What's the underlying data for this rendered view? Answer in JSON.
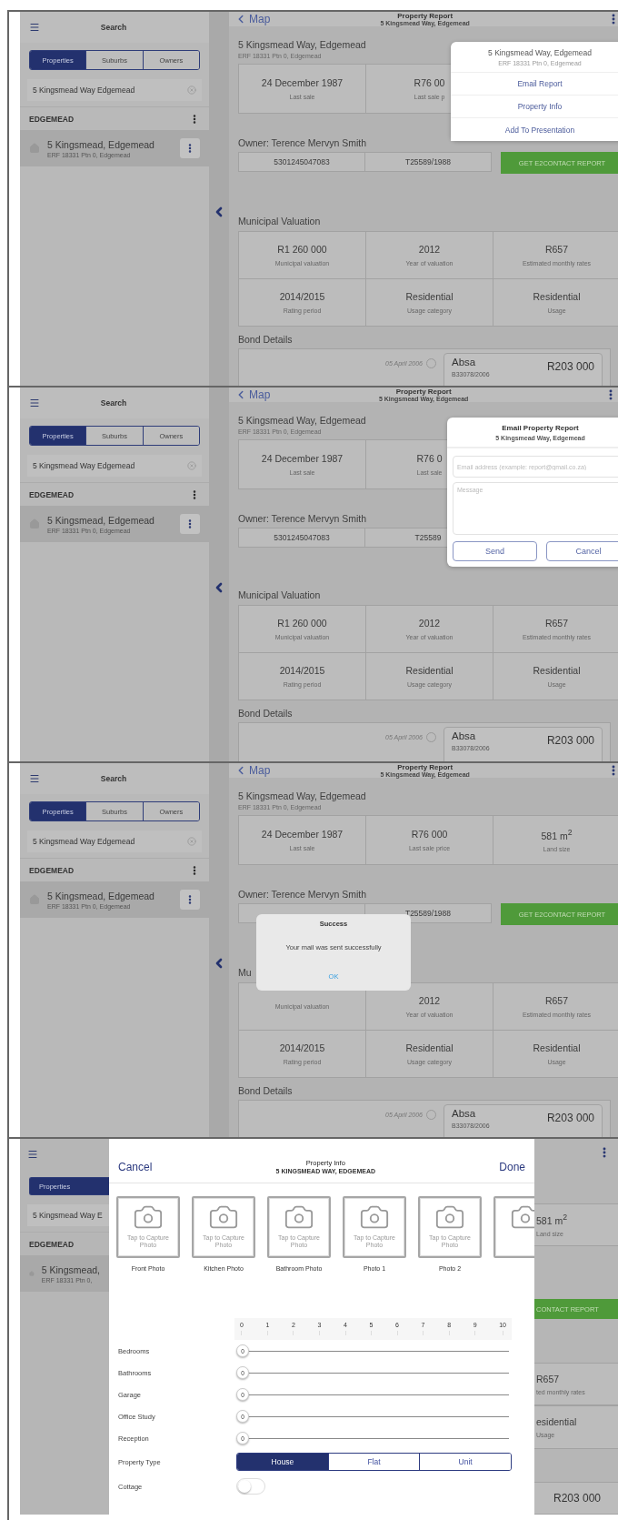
{
  "panels": [
    {
      "kind": "menu",
      "screen": {
        "sidebar": {
          "title": "Search",
          "tabs": [
            {
              "label": "Properties",
              "selected": true
            },
            {
              "label": "Suburbs",
              "selected": false
            },
            {
              "label": "Owners",
              "selected": false
            }
          ],
          "search": {
            "value": "5 Kingsmead Way Edgemead"
          },
          "group": "EDGEMEAD",
          "result": {
            "title": "5 Kingsmead, Edgemead",
            "subtitle": "ERF 18331 Ptn 0, Edgemead",
            "selected": true
          }
        },
        "nav": {
          "back": "Map",
          "title": "Property Report",
          "subtitle": "5 Kingsmead Way, Edgemead"
        },
        "property": {
          "address": "5 Kingsmead Way, Edgemead",
          "erf": "ERF 18331 Ptn 0, Edgemead"
        },
        "stats": [
          {
            "value": "24 December 1987",
            "label": "Last sale"
          },
          {
            "value": "R76 00",
            "label": "Last sale p"
          }
        ],
        "owner": {
          "heading": "Owner: Terence Mervyn Smith",
          "ids": [
            "5301245047083",
            "T25589/1988"
          ],
          "button": "GET E2CONTACT REPORT"
        },
        "valuation": {
          "heading": "Municipal Valuation",
          "cells": [
            {
              "value": "R1 260 000",
              "label": "Municipal valuation"
            },
            {
              "value": "2012",
              "label": "Year of valuation"
            },
            {
              "value": "R657",
              "label": "Estimated monthly rates"
            },
            {
              "value": "2014/2015",
              "label": "Rating period"
            },
            {
              "value": "Residential",
              "label": "Usage category"
            },
            {
              "value": "Residential",
              "label": "Usage"
            }
          ]
        },
        "bond": {
          "heading": "Bond Details",
          "date": "05 April 2006",
          "bank": "Absa",
          "reference": "B33078/2006",
          "amount": "R203 000"
        }
      },
      "menu": {
        "title": "5 Kingsmead Way, Edgemead",
        "subtitle": "ERF 18331 Ptn 0, Edgemead",
        "items": [
          "Email Report",
          "Property Info",
          "Add To Presentation"
        ]
      }
    },
    {
      "kind": "email",
      "screen": {
        "sidebar": {
          "title": "Search",
          "tabs": [
            {
              "label": "Properties",
              "selected": true
            },
            {
              "label": "Suburbs",
              "selected": false
            },
            {
              "label": "Owners",
              "selected": false
            }
          ],
          "search": {
            "value": "5 Kingsmead Way Edgemead"
          },
          "group": "EDGEMEAD",
          "result": {
            "title": "5 Kingsmead, Edgemead",
            "subtitle": "ERF 18331 Ptn 0, Edgemead",
            "selected": true
          }
        },
        "nav": {
          "back": "Map",
          "title": "Property Report",
          "subtitle": "5 Kingsmead Way, Edgemead"
        },
        "property": {
          "address": "5 Kingsmead Way, Edgemead",
          "erf": "ERF 18331 Ptn 0, Edgemead"
        },
        "stats": [
          {
            "value": "24 December 1987",
            "label": "Last sale"
          },
          {
            "value": "R76 0",
            "label": "Last sale"
          }
        ],
        "owner": {
          "heading": "Owner: Terence Mervyn Smith",
          "ids": [
            "5301245047083",
            "T25589"
          ]
        },
        "valuation": {
          "heading": "Municipal Valuation",
          "cells": [
            {
              "value": "R1 260 000",
              "label": "Municipal valuation"
            },
            {
              "value": "2012",
              "label": "Year of valuation"
            },
            {
              "value": "R657",
              "label": "Estimated monthly rates"
            },
            {
              "value": "2014/2015",
              "label": "Rating period"
            },
            {
              "value": "Residential",
              "label": "Usage category"
            },
            {
              "value": "Residential",
              "label": "Usage"
            }
          ]
        },
        "bond": {
          "heading": "Bond Details",
          "date": "05 April 2006",
          "bank": "Absa",
          "reference": "B33078/2006",
          "amount": "R203 000"
        }
      },
      "email_form": {
        "title": "Email Property Report",
        "subtitle": "5 Kingsmead Way, Edgemead",
        "email": {
          "placeholder": "Email address (example: report@gmail.co.za)"
        },
        "message": {
          "placeholder": "Message"
        },
        "buttons": [
          "Send",
          "Cancel"
        ]
      }
    },
    {
      "kind": "alert",
      "screen": {
        "sidebar": {
          "title": "Search",
          "tabs": [
            {
              "label": "Properties",
              "selected": true
            },
            {
              "label": "Suburbs",
              "selected": false
            },
            {
              "label": "Owners",
              "selected": false
            }
          ],
          "search": {
            "value": "5 Kingsmead Way Edgemead"
          },
          "group": "EDGEMEAD",
          "result": {
            "title": "5 Kingsmead, Edgemead",
            "subtitle": "ERF 18331 Ptn 0, Edgemead",
            "selected": true
          }
        },
        "nav": {
          "back": "Map",
          "title": "Property Report",
          "subtitle": "5 Kingsmead Way, Edgemead"
        },
        "property": {
          "address": "5 Kingsmead Way, Edgemead",
          "erf": "ERF 18331 Ptn 0, Edgemead"
        },
        "stats": [
          {
            "value": "24 December 1987",
            "label": "Last sale"
          },
          {
            "value": "R76 000",
            "label": "Last sale price"
          },
          {
            "value": "581 m$^{2}$",
            "label": "Land size"
          }
        ],
        "owner": {
          "heading": "Owner: Terence Mervyn Smith",
          "ids": [
            "T25589/1988"
          ],
          "button": "GET E2CONTACT REPORT"
        },
        "valuation": {
          "heading": "Mu",
          "cells": [
            {
              "label": "Municipal valuation"
            },
            {
              "value": "2012",
              "label": "Year of valuation"
            },
            {
              "value": "R657",
              "label": "Estimated monthly rates"
            },
            {
              "value": "2014/2015",
              "label": "Rating period"
            },
            {
              "value": "Residential",
              "label": "Usage category"
            },
            {
              "value": "Residential",
              "label": "Usage"
            }
          ]
        },
        "bond": {
          "heading": "Bond Details",
          "date": "05 April 2006",
          "bank": "Absa",
          "reference": "B33078/2006",
          "amount": "R203 000"
        }
      },
      "alert": {
        "title": "Success",
        "message": "Your mail was sent successfully",
        "button": "OK"
      }
    },
    {
      "kind": "property_info",
      "left_strip": {
        "tab": {
          "label": "Properties",
          "selected": true
        },
        "search_value": "5 Kingsmead Way E",
        "group": "EDGEMEAD",
        "result_title": "5 Kingsmead,",
        "result_subtitle": "ERF 18331 Ptn 0,"
      },
      "right_strip": {
        "stat": {
          "value": "581 m$^{2}$",
          "label": "Land size"
        },
        "button": "CONTACT REPORT",
        "cells": [
          {
            "value": "R657",
            "label": "ted monthly rates"
          },
          {
            "value": "esidential",
            "label": "Usage"
          }
        ],
        "amount": "R203 000"
      },
      "property_info": {
        "cancel": "Cancel",
        "title": "Property Info",
        "subtitle": "5 KINGSMEAD WAY, EDGEMEAD",
        "done": "Done",
        "photos": [
          {
            "kind": "full",
            "caption": "Tap to Capture Photo",
            "label": "Front Photo"
          },
          {
            "kind": "full",
            "caption": "Tap to Capture Photo",
            "label": "Kitchen Photo"
          },
          {
            "kind": "full",
            "caption": "Tap to Capture Photo",
            "label": "Bathroom Photo"
          },
          {
            "kind": "full",
            "caption": "Tap to Capture Photo",
            "label": "Photo 1"
          },
          {
            "kind": "full",
            "caption": "Tap to Capture Photo",
            "label": "Photo 2"
          },
          {
            "kind": "cut"
          }
        ],
        "scale": [
          "0",
          "1",
          "2",
          "3",
          "4",
          "5",
          "6",
          "7",
          "8",
          "9",
          "10"
        ],
        "counters": [
          {
            "label": "Bedrooms",
            "value": "0",
            "level": 0
          },
          {
            "label": "Bathrooms",
            "value": "0",
            "level": 0
          },
          {
            "label": "Garage",
            "value": "0",
            "level": 0
          },
          {
            "label": "Office Study",
            "value": "0",
            "level": 0
          },
          {
            "label": "Reception",
            "value": "0",
            "level": 0
          }
        ],
        "property_type": {
          "label": "Property Type",
          "options": [
            {
              "label": "House",
              "selected": true
            },
            {
              "label": "Flat",
              "selected": false
            },
            {
              "label": "Unit",
              "selected": false
            }
          ]
        },
        "cottage": {
          "label": "Cottage",
          "on": false
        }
      }
    }
  ]
}
